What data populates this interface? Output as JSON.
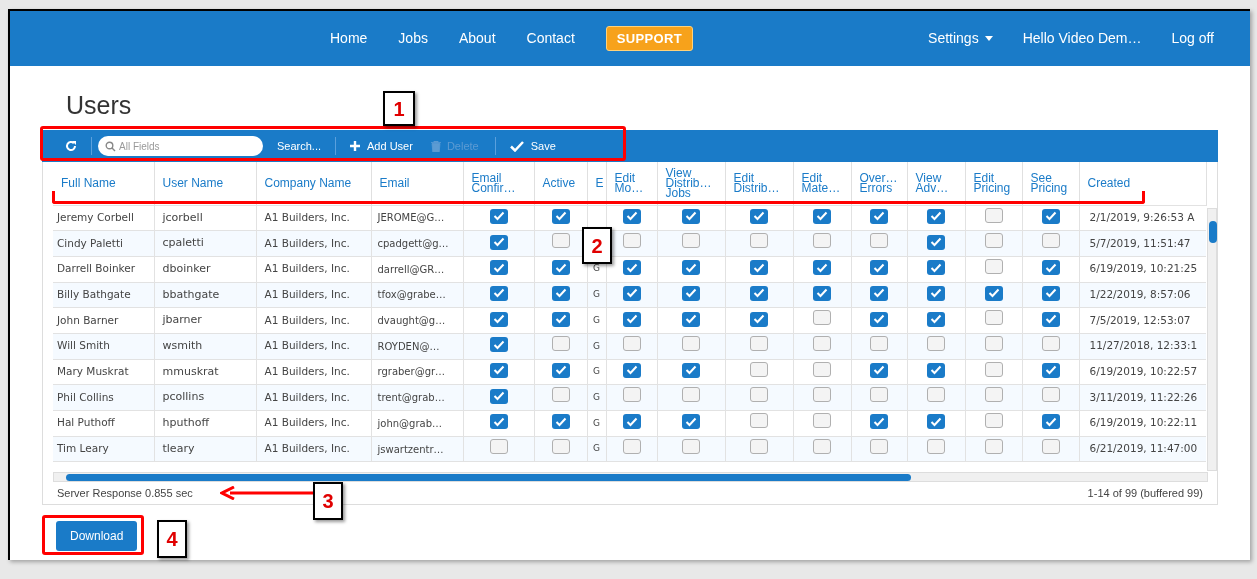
{
  "nav": {
    "items": [
      {
        "label": "Home",
        "kind": "link"
      },
      {
        "label": "Jobs",
        "kind": "link"
      },
      {
        "label": "About",
        "kind": "link"
      },
      {
        "label": "Contact",
        "kind": "link"
      },
      {
        "label": "SUPPORT",
        "kind": "badge"
      }
    ],
    "right": [
      {
        "label": "Settings",
        "kind": "dropdown"
      },
      {
        "label": "Hello Video Dem…",
        "kind": "link"
      },
      {
        "label": "Log off",
        "kind": "link"
      }
    ]
  },
  "title": "Users",
  "toolbar": {
    "search": {
      "placeholder": "All Fields"
    },
    "search_button": "Search...",
    "add": "Add User",
    "delete": {
      "label": "Delete",
      "disabled": true
    },
    "save": "Save"
  },
  "table": {
    "columns": [
      "Full Name",
      "User Name",
      "Company Name",
      "Email",
      "Email\nConfir…",
      "Active",
      "E",
      "Edit\nMo…",
      "View\nDistrib…\nJobs",
      "Edit\nDistrib…",
      "Edit\nMate…",
      "Over…\nErrors",
      "View\nAdv…",
      "Edit\nPricing",
      "See\nPricing",
      "Created"
    ],
    "rows": [
      {
        "full_name": "Jeremy Corbell",
        "user_name": "jcorbell",
        "company": "A1 Builders, Inc.",
        "email": "JEROME@G…",
        "email_confirmed": true,
        "active": true,
        "perms": [
          true,
          true,
          true,
          true,
          true,
          true,
          false,
          true
        ],
        "created": "2/1/2019, 9:26:53 A"
      },
      {
        "full_name": "Cindy Paletti",
        "user_name": "cpaletti",
        "company": "A1 Builders, Inc.",
        "email": "cpadgett@g…",
        "email_confirmed": true,
        "active": false,
        "perms": [
          false,
          false,
          false,
          false,
          false,
          true,
          false,
          false
        ],
        "created": "5/7/2019, 11:51:47"
      },
      {
        "full_name": "Darrell Boinker",
        "user_name": "dboinker",
        "company": "A1 Builders, Inc.",
        "email": "darrell@GR…",
        "email_confirmed": true,
        "active": true,
        "code": "G",
        "perms": [
          true,
          true,
          true,
          true,
          true,
          true,
          false,
          true
        ],
        "created": "6/19/2019, 10:21:25"
      },
      {
        "full_name": "Billy Bathgate",
        "user_name": "bbathgate",
        "company": "A1 Builders, Inc.",
        "email": "tfox@grabe…",
        "email_confirmed": true,
        "active": true,
        "code": "G",
        "perms": [
          true,
          true,
          true,
          true,
          true,
          true,
          true,
          true
        ],
        "created": "1/22/2019, 8:57:06"
      },
      {
        "full_name": "John Barner",
        "user_name": "jbarner",
        "company": "A1 Builders, Inc.",
        "email": "dvaught@g…",
        "email_confirmed": true,
        "active": true,
        "code": "G",
        "perms": [
          true,
          true,
          true,
          false,
          true,
          true,
          false,
          true
        ],
        "created": "7/5/2019, 12:53:07"
      },
      {
        "full_name": "Will Smith",
        "user_name": "wsmith",
        "company": "A1 Builders, Inc.",
        "email": "ROYDEN@…",
        "email_confirmed": true,
        "active": false,
        "code": "G",
        "perms": [
          false,
          false,
          false,
          false,
          false,
          false,
          false,
          false
        ],
        "created": "11/27/2018, 12:33:1"
      },
      {
        "full_name": "Mary Muskrat",
        "user_name": "mmuskrat",
        "company": "A1 Builders, Inc.",
        "email": "rgraber@gr…",
        "email_confirmed": true,
        "active": true,
        "code": "G",
        "perms": [
          true,
          true,
          false,
          false,
          true,
          true,
          false,
          true
        ],
        "created": "6/19/2019, 10:22:57"
      },
      {
        "full_name": "Phil Collins",
        "user_name": "pcollins",
        "company": "A1 Builders, Inc.",
        "email": "trent@grab…",
        "email_confirmed": true,
        "active": false,
        "code": "G",
        "perms": [
          false,
          false,
          false,
          false,
          false,
          false,
          false,
          false
        ],
        "created": "3/11/2019, 11:22:26"
      },
      {
        "full_name": "Hal Puthoff",
        "user_name": "hputhoff",
        "company": "A1 Builders, Inc.",
        "email": "john@grab…",
        "email_confirmed": true,
        "active": true,
        "code": "G",
        "perms": [
          true,
          true,
          false,
          false,
          true,
          true,
          false,
          true
        ],
        "created": "6/19/2019, 10:22:11"
      },
      {
        "full_name": "Tim Leary",
        "user_name": "tleary",
        "company": "A1 Builders, Inc.",
        "email": "jswartzentr…",
        "email_confirmed": false,
        "active": false,
        "code": "G",
        "perms": [
          false,
          false,
          false,
          false,
          false,
          false,
          false,
          false
        ],
        "created": "6/21/2019, 11:47:00"
      }
    ]
  },
  "status": {
    "left": "Server Response 0.855 sec",
    "right": "1-14 of 99 (buffered 99)"
  },
  "download": "Download",
  "callouts": [
    "1",
    "2",
    "3",
    "4"
  ]
}
